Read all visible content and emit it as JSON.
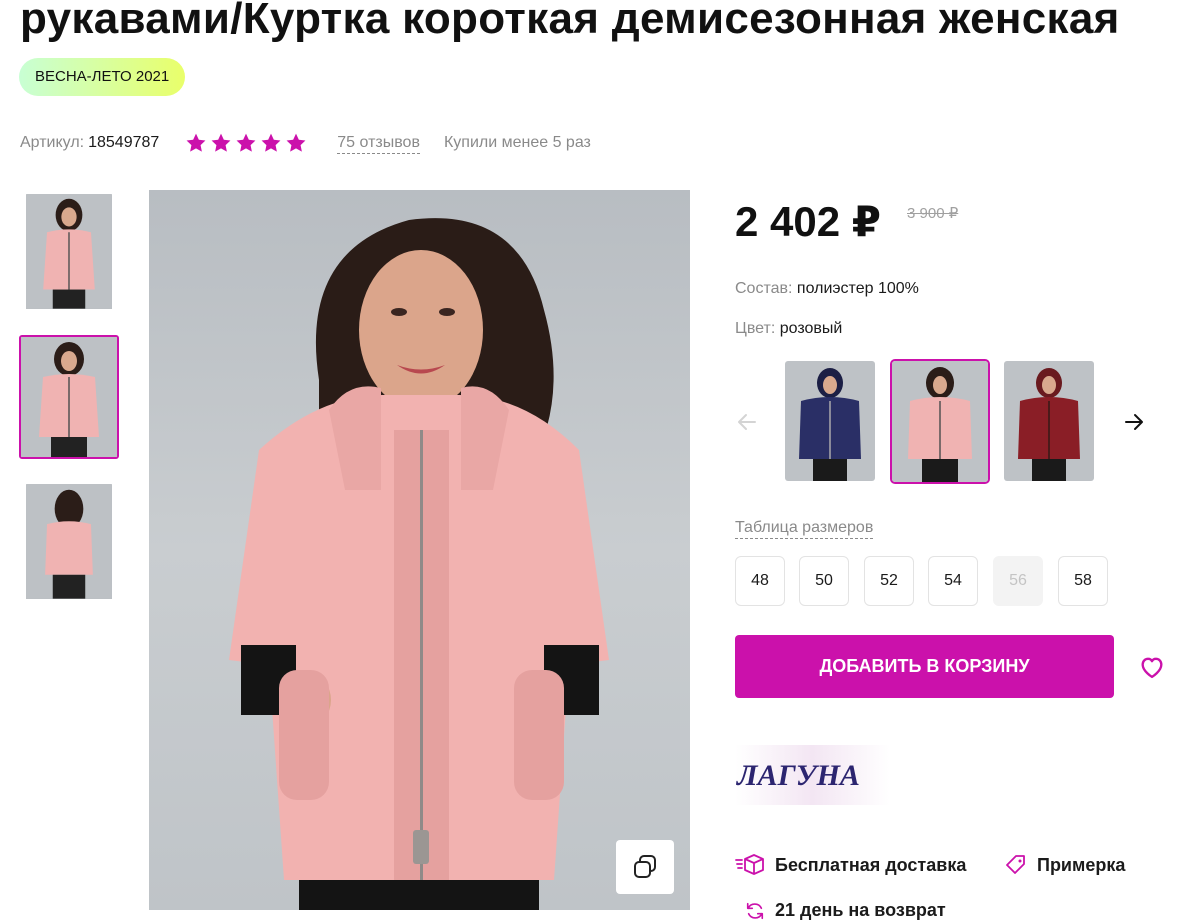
{
  "product": {
    "title": "рукавами/Куртка короткая демисезонная женская",
    "season_badge": "ВЕСНА-ЛЕТО 2021",
    "article_label": "Артикул:",
    "article_value": "18549787",
    "rating_stars": 5,
    "reviews_link": "75 отзывов",
    "bought_text": "Купили менее 5 раз",
    "price": "2 402 ₽",
    "old_price": "3 900 ₽",
    "composition_label": "Состав:",
    "composition_value": "полиэстер 100%",
    "color_label": "Цвет:",
    "color_value": "розовый",
    "size_table_link": "Таблица размеров",
    "sizes": [
      {
        "label": "48",
        "available": true
      },
      {
        "label": "50",
        "available": true
      },
      {
        "label": "52",
        "available": true
      },
      {
        "label": "54",
        "available": true
      },
      {
        "label": "56",
        "available": false
      },
      {
        "label": "58",
        "available": true
      }
    ],
    "add_to_cart": "ДОБАВИТЬ В КОРЗИНУ",
    "brand_logo_text": "ЛАГУНА",
    "features": {
      "delivery": "Бесплатная доставка",
      "fitting": "Примерка",
      "return": "21 день на возврат"
    }
  },
  "gallery": {
    "active_index": 1,
    "thumbnail_count": 3
  },
  "color_options": [
    {
      "name": "синий",
      "swatch": "#2a2f66"
    },
    {
      "name": "розовый",
      "swatch": "#e8a6a8",
      "active": true
    },
    {
      "name": "бордовый",
      "swatch": "#8a1e26"
    }
  ],
  "colors": {
    "accent": "#cb11ab",
    "badge_gradient_start": "#c8ffd4",
    "badge_gradient_end": "#e9ff6a",
    "star": "#cb11ab"
  },
  "icons": [
    "star-icon",
    "zoom-icon",
    "arrow-left-icon",
    "arrow-right-icon",
    "heart-icon",
    "delivery-box-icon",
    "tag-icon",
    "return-icon"
  ]
}
